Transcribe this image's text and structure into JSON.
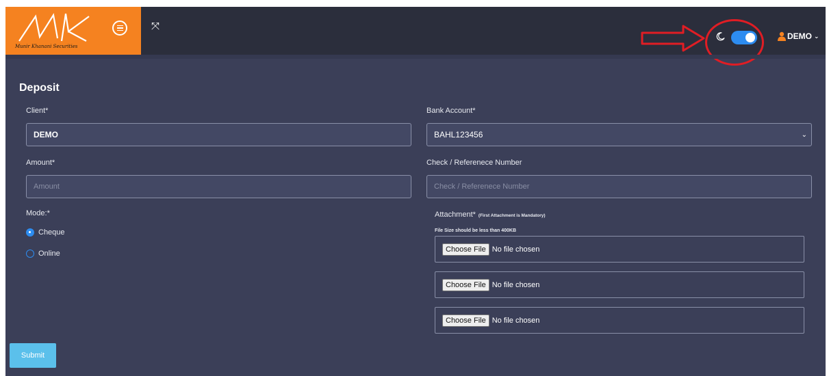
{
  "brand": {
    "logo_caption": "Munir Khanani Securities"
  },
  "header": {
    "user_label": "DEMO"
  },
  "theme_toggle": {
    "dark_mode": true,
    "accent": "#2d8cf0"
  },
  "annotation": {
    "color": "#e01d24"
  },
  "form": {
    "title": "Deposit",
    "client": {
      "label": "Client*",
      "value": "DEMO"
    },
    "bank_account": {
      "label": "Bank Account*",
      "value": "BAHL123456"
    },
    "amount": {
      "label": "Amount*",
      "placeholder": "Amount"
    },
    "reference": {
      "label": "Check / Referenece Number",
      "placeholder": "Check / Referenece Number"
    },
    "mode": {
      "label": "Mode:*",
      "options": [
        {
          "label": "Cheque",
          "selected": true
        },
        {
          "label": "Online",
          "selected": false
        }
      ]
    },
    "attachment": {
      "label": "Attachment*",
      "note": "(First Attachment is Mandatory)",
      "size_note": "File Size should be less than 400KB",
      "choose_label": "Choose File",
      "no_file_label": "No file chosen"
    },
    "submit_label": "Submit"
  }
}
